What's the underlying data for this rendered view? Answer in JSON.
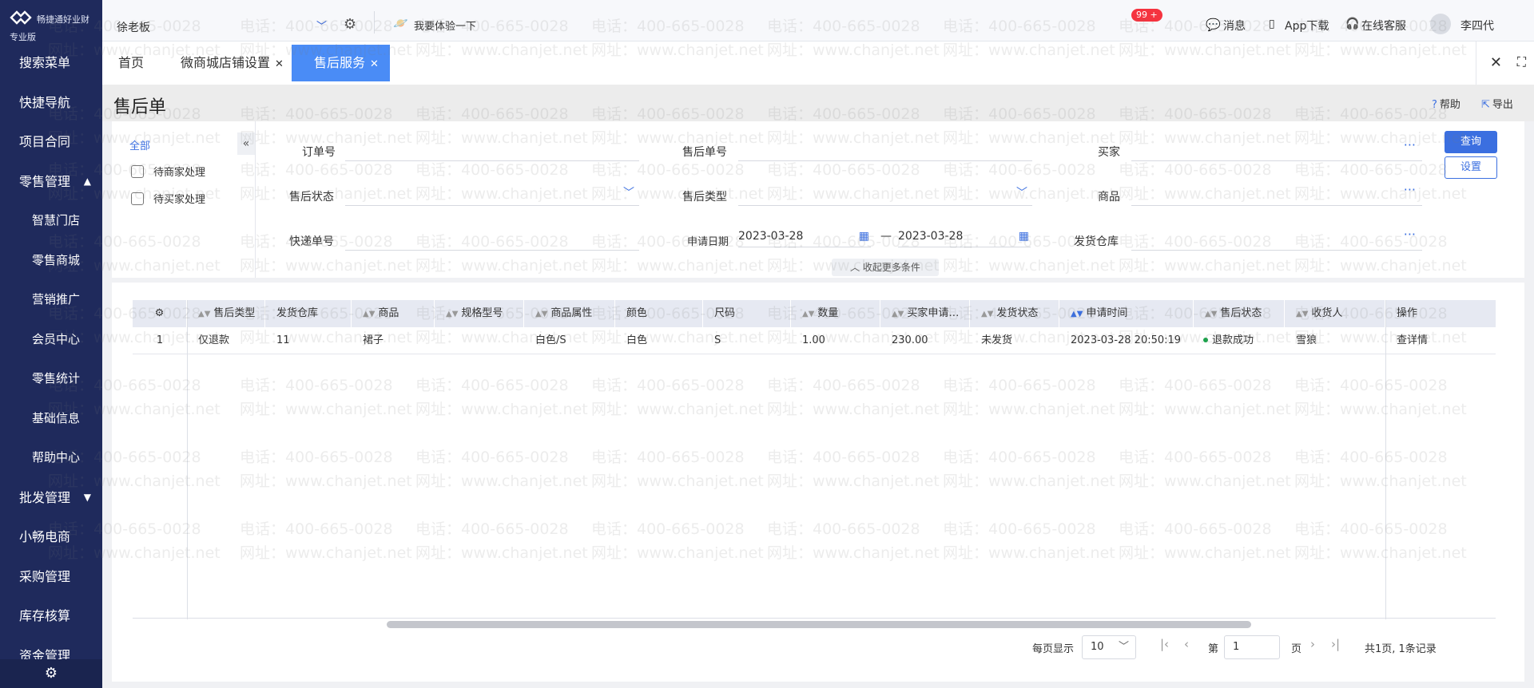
{
  "sidebar": {
    "brand": "畅捷通好业财",
    "edition": "专业版",
    "items": [
      {
        "label": "搜索菜单",
        "sub": false
      },
      {
        "label": "快捷导航",
        "sub": false
      },
      {
        "label": "项目合同",
        "sub": false
      },
      {
        "label": "零售管理",
        "sub": false,
        "caret": "▲"
      },
      {
        "label": "智慧门店",
        "sub": true
      },
      {
        "label": "零售商城",
        "sub": true
      },
      {
        "label": "营销推广",
        "sub": true
      },
      {
        "label": "会员中心",
        "sub": true
      },
      {
        "label": "零售统计",
        "sub": true
      },
      {
        "label": "基础信息",
        "sub": true
      },
      {
        "label": "帮助中心",
        "sub": true
      },
      {
        "label": "批发管理",
        "sub": false,
        "caret": "▼"
      },
      {
        "label": "小畅电商",
        "sub": false
      },
      {
        "label": "采购管理",
        "sub": false
      },
      {
        "label": "库存核算",
        "sub": false
      },
      {
        "label": "资金管理",
        "sub": false
      }
    ],
    "settings_icon": "⚙"
  },
  "topbar": {
    "account": "徐老板",
    "try_label": "我要体验一下",
    "messages_label": "消息",
    "messages_badge": "99 +",
    "app_download": "App下载",
    "online_service": "在线客服",
    "user_name": "李四代"
  },
  "tabs": [
    {
      "label": "首页"
    },
    {
      "label": "微商城店铺设置"
    },
    {
      "label": "售后服务"
    }
  ],
  "page": {
    "title": "售后单",
    "help": "帮助",
    "export": "导出"
  },
  "filter": {
    "status_all": "全部",
    "status_items": [
      "待商家处理",
      "待买家处理"
    ],
    "fields": {
      "order_no": "订单号",
      "after_sale_no": "售后单号",
      "buyer": "买家",
      "after_sale_status": "售后状态",
      "after_sale_type": "售后类型",
      "product": "商品",
      "express_no": "快递单号",
      "apply_date": "申请日期",
      "date_from": "2023-03-28",
      "date_sep": "—",
      "date_to": "2023-03-28",
      "warehouse": "发货仓库"
    },
    "query_btn": "查询",
    "settings_btn": "设置",
    "fold_btn": "收起更多条件"
  },
  "table": {
    "headers": [
      "售后类型",
      "发货仓库",
      "商品",
      "规格型号",
      "商品属性",
      "颜色",
      "尺码",
      "数量",
      "买家申请…",
      "发货状态",
      "申请时间",
      "售后状态",
      "收货人",
      "操作"
    ],
    "rows": [
      {
        "idx": "1",
        "type": "仅退款",
        "warehouse": "11",
        "product": "裙子",
        "spec": "",
        "attr": "白色/S",
        "color": "白色",
        "size": "S",
        "qty": "1.00",
        "buyer_amount": "230.00",
        "ship_status": "未发货",
        "apply_time": "2023-03-28 20:50:19",
        "after_status": "退款成功",
        "receiver": "雪狼",
        "action": "查详情"
      }
    ]
  },
  "pager": {
    "per_page_label": "每页显示",
    "per_page": "10",
    "page_prefix": "第",
    "page": "1",
    "page_suffix": "页",
    "summary": "共1页, 1条记录"
  },
  "watermark": {
    "phone": "电话：400-665-0028",
    "site": "网址：www.chanjet.net"
  },
  "colors": {
    "sidebar": "#1f2a5c",
    "accent": "#3b6fe0",
    "active_tab": "#4a8cf6",
    "badge": "#f5333f"
  }
}
